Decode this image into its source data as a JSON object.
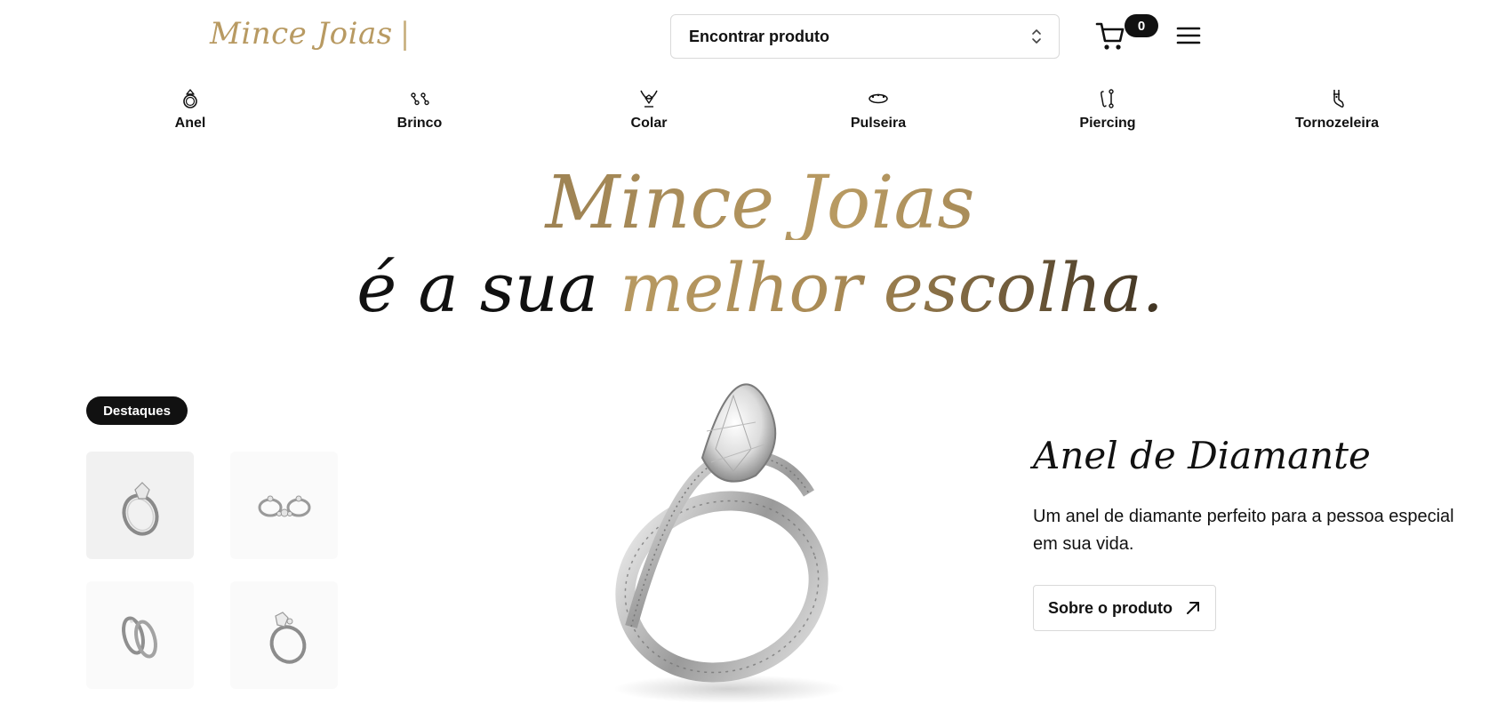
{
  "header": {
    "logo_text": "Mince Joias",
    "logo_cursor": "|",
    "search_placeholder": "Encontrar produto",
    "cart_count": "0"
  },
  "categories": [
    {
      "label": "Anel",
      "icon": "ring-icon"
    },
    {
      "label": "Brinco",
      "icon": "earring-icon"
    },
    {
      "label": "Colar",
      "icon": "necklace-icon"
    },
    {
      "label": "Pulseira",
      "icon": "bracelet-icon"
    },
    {
      "label": "Piercing",
      "icon": "piercing-icon"
    },
    {
      "label": "Tornozeleira",
      "icon": "anklet-icon"
    }
  ],
  "hero": {
    "line1": "Mince Joias",
    "line2_part1": "é a sua ",
    "line2_part2": "melhor escolha."
  },
  "highlights": {
    "label": "Destaques",
    "items": [
      {
        "icon": "diamond-ring-icon",
        "active": true
      },
      {
        "icon": "ring-set-icon",
        "active": false
      },
      {
        "icon": "wedding-bands-icon",
        "active": false
      },
      {
        "icon": "solitaire-ring-icon",
        "active": false
      }
    ]
  },
  "product": {
    "title": "Anel de Diamante",
    "description": "Um anel de diamante perfeito para a pessoa especial em sua vida.",
    "button_label": "Sobre o produto",
    "button_icon": "arrow-up-right-icon"
  },
  "colors": {
    "gold": "#b89a62",
    "dark": "#111111",
    "border": "#d9d9d9"
  }
}
